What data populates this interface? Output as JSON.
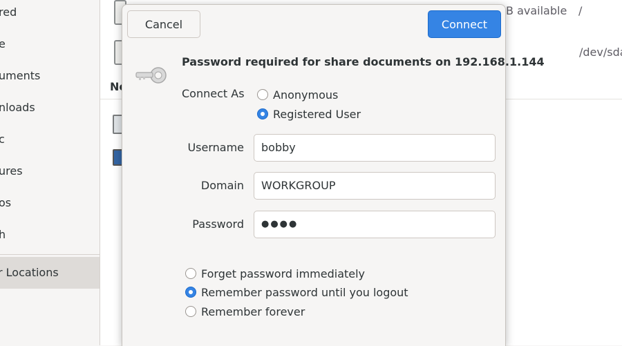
{
  "background": {
    "sidebar": {
      "items": [
        "red",
        "e",
        "uments",
        "nloads",
        "c",
        "ures",
        "os",
        "h"
      ],
      "active_item": "r Locations"
    },
    "main": {
      "row1_info": "B available",
      "row1_mount": "/",
      "row2_mount": "/dev/sda",
      "section_heading": "Ne"
    }
  },
  "dialog": {
    "cancel_label": "Cancel",
    "connect_label": "Connect",
    "prompt": "Password required for share documents on 192.168.1.144",
    "connect_as_label": "Connect As",
    "connect_as_options": [
      "Anonymous",
      "Registered User"
    ],
    "connect_as_selected": "Registered User",
    "username_label": "Username",
    "username_value": "bobby",
    "domain_label": "Domain",
    "domain_value": "WORKGROUP",
    "password_label": "Password",
    "password_value": "●●●●",
    "remember_options": [
      "Forget password immediately",
      "Remember password until you logout",
      "Remember forever"
    ],
    "remember_selected": "Remember password until you logout"
  },
  "colors": {
    "accent": "#3584e4",
    "dialog_bg": "#f6f5f4",
    "text": "#2e3436"
  }
}
